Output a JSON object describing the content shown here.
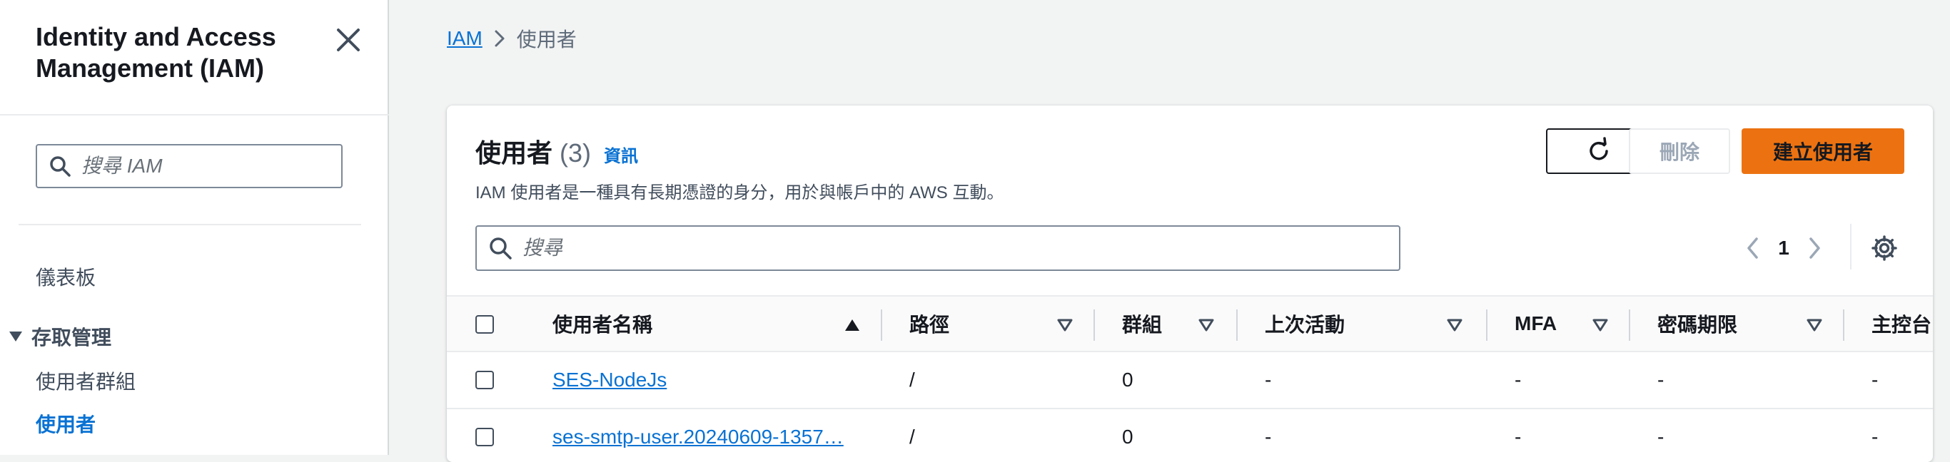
{
  "sidebar": {
    "title": "Identity and Access Management (IAM)",
    "search_placeholder": "搜尋 IAM",
    "dashboard": "儀表板",
    "section_access": "存取管理",
    "item_user_groups": "使用者群組",
    "item_users": "使用者"
  },
  "breadcrumb": {
    "root": "IAM",
    "current": "使用者"
  },
  "header": {
    "title": "使用者",
    "count": "(3)",
    "info": "資訊",
    "description": "IAM 使用者是一種具有長期憑證的身分，用於與帳戶中的 AWS 互動。"
  },
  "actions": {
    "delete": "刪除",
    "create": "建立使用者"
  },
  "search": {
    "placeholder": "搜尋"
  },
  "pagination": {
    "page": "1"
  },
  "table": {
    "columns": {
      "username": "使用者名稱",
      "path": "路徑",
      "groups": "群組",
      "last_activity": "上次活動",
      "mfa": "MFA",
      "password_age": "密碼期限",
      "console": "主控台"
    },
    "rows": [
      {
        "username": "SES-NodeJs",
        "path": "/",
        "groups": "0",
        "last_activity": "-",
        "mfa": "-",
        "password_age": "-",
        "console": "-"
      },
      {
        "username": "ses-smtp-user.20240609-1357…",
        "path": "/",
        "groups": "0",
        "last_activity": "-",
        "mfa": "-",
        "password_age": "-",
        "console": "-"
      }
    ]
  },
  "colors": {
    "link": "#0972d3",
    "primary_button": "#ec7211"
  }
}
